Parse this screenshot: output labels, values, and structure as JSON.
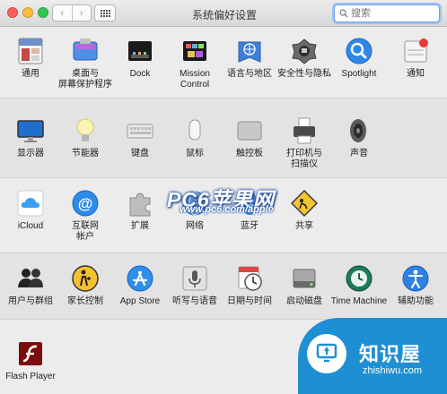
{
  "window": {
    "title": "系统偏好设置"
  },
  "search": {
    "placeholder": "搜索",
    "value": ""
  },
  "nav": {
    "back": "‹",
    "forward": "›"
  },
  "sections": {
    "personal": [
      {
        "label": "通用",
        "icon": "general-icon"
      },
      {
        "label": "桌面与\n屏幕保护程序",
        "icon": "desktop-icon"
      },
      {
        "label": "Dock",
        "icon": "dock-icon"
      },
      {
        "label": "Mission\nControl",
        "icon": "mission-control-icon"
      },
      {
        "label": "语言与地区",
        "icon": "language-icon"
      },
      {
        "label": "安全性与隐私",
        "icon": "security-icon"
      },
      {
        "label": "Spotlight",
        "icon": "spotlight-icon"
      },
      {
        "label": "通知",
        "icon": "notifications-icon"
      }
    ],
    "hardware": [
      {
        "label": "显示器",
        "icon": "displays-icon"
      },
      {
        "label": "节能器",
        "icon": "energy-saver-icon"
      },
      {
        "label": "键盘",
        "icon": "keyboard-icon"
      },
      {
        "label": "鼠标",
        "icon": "mouse-icon"
      },
      {
        "label": "触控板",
        "icon": "trackpad-icon"
      },
      {
        "label": "打印机与\n扫描仪",
        "icon": "printer-icon"
      },
      {
        "label": "声音",
        "icon": "sound-icon"
      }
    ],
    "internet": [
      {
        "label": "iCloud",
        "icon": "icloud-icon"
      },
      {
        "label": "互联网\n帐户",
        "icon": "internet-accounts-icon"
      },
      {
        "label": "扩展",
        "icon": "extensions-icon"
      },
      {
        "label": "网络",
        "icon": "network-icon"
      },
      {
        "label": "蓝牙",
        "icon": "bluetooth-icon"
      },
      {
        "label": "共享",
        "icon": "sharing-icon"
      }
    ],
    "system": [
      {
        "label": "用户与群组",
        "icon": "users-icon"
      },
      {
        "label": "家长控制",
        "icon": "parental-controls-icon"
      },
      {
        "label": "App Store",
        "icon": "app-store-icon"
      },
      {
        "label": "听写与语音",
        "icon": "dictation-icon"
      },
      {
        "label": "日期与时间",
        "icon": "date-time-icon"
      },
      {
        "label": "启动磁盘",
        "icon": "startup-disk-icon"
      },
      {
        "label": "Time Machine",
        "icon": "time-machine-icon"
      },
      {
        "label": "辅助功能",
        "icon": "accessibility-icon"
      }
    ],
    "other": [
      {
        "label": "Flash Player",
        "icon": "flash-player-icon"
      }
    ]
  },
  "watermarks": {
    "pc6": "PC6苹果网",
    "pc6_url": "www.pc6.com/apple",
    "zhishiwu": "知识屋",
    "zhishiwu_url": "zhishiwu.com"
  },
  "colors": {
    "accent": "#1f8fd4",
    "search_focus": "#6fa0e7"
  }
}
